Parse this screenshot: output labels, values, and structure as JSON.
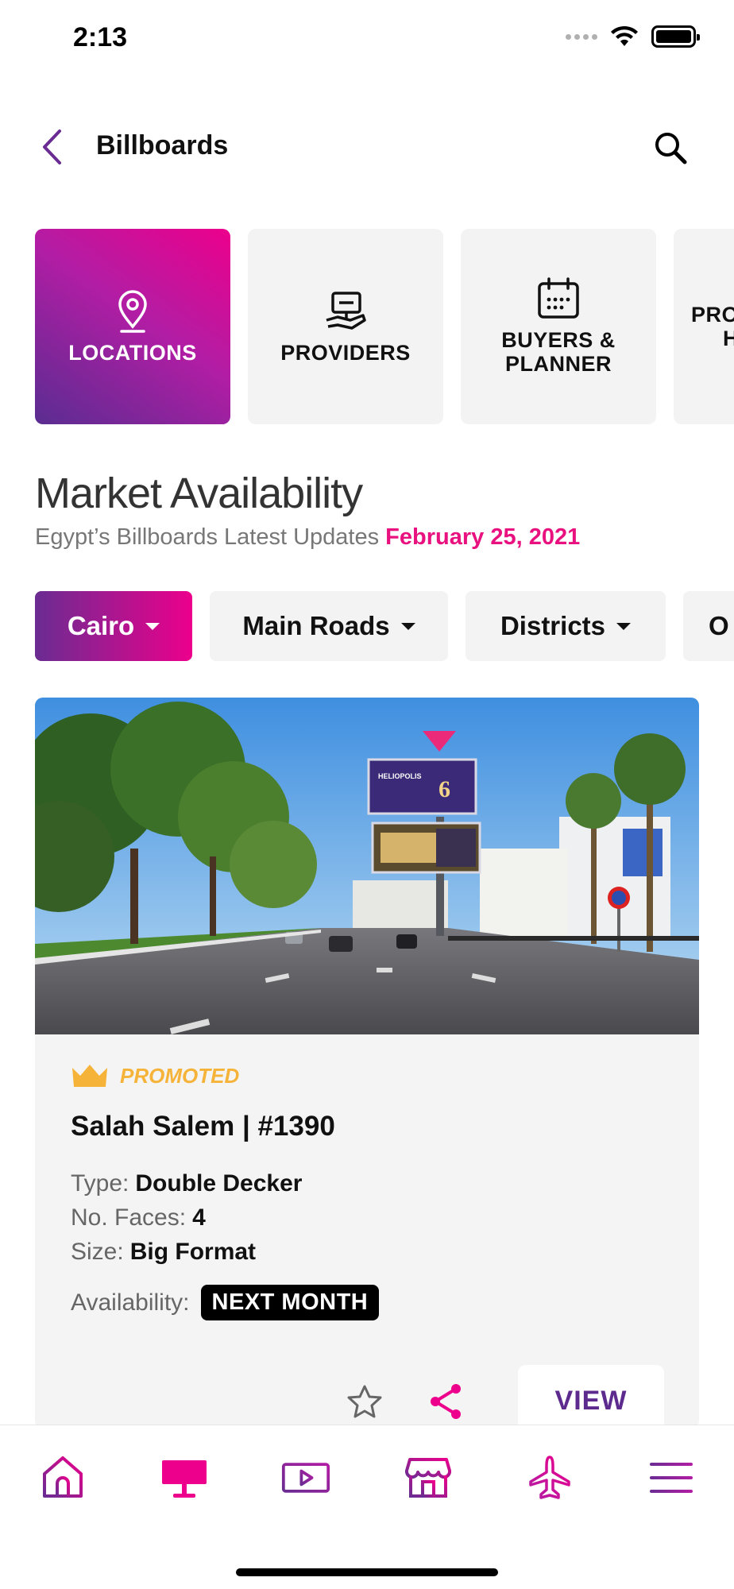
{
  "status_bar": {
    "time": "2:13"
  },
  "header": {
    "title": "Billboards"
  },
  "tiles": [
    {
      "label": "LOCATIONS",
      "icon": "location-pin-icon",
      "active": true
    },
    {
      "label": "PROVIDERS",
      "icon": "provider-icon",
      "active": false
    },
    {
      "label": "BUYERS & PLANNER",
      "icon": "calendar-icon",
      "active": false
    },
    {
      "label": "PRO H",
      "active": false
    }
  ],
  "market": {
    "title": "Market Availability",
    "subtitle": "Egypt’s Billboards Latest Updates",
    "date": "February 25, 2021"
  },
  "filters": [
    {
      "label": "Cairo",
      "active": true
    },
    {
      "label": "Main Roads",
      "active": false
    },
    {
      "label": "Districts",
      "active": false
    },
    {
      "label": "O",
      "active": false
    }
  ],
  "card": {
    "promoted_label": "PROMOTED",
    "title": "Salah Salem | #1390",
    "type_label": "Type:",
    "type_value": "Double Decker",
    "faces_label": "No. Faces:",
    "faces_value": "4",
    "size_label": "Size:",
    "size_value": "Big Format",
    "availability_label": "Availability:",
    "availability_value": "NEXT MONTH",
    "view_label": "VIEW",
    "billboard_top_text": "HELIOPOLIS",
    "billboard_number": "6"
  },
  "nav": [
    {
      "icon": "home-icon"
    },
    {
      "icon": "billboard-icon",
      "active": true
    },
    {
      "icon": "video-icon"
    },
    {
      "icon": "store-icon"
    },
    {
      "icon": "airplane-icon"
    },
    {
      "icon": "menu-icon"
    }
  ],
  "colors": {
    "accent_pink": "#ec008c",
    "accent_purple": "#5d2a8e",
    "promoted_gold": "#f6b339"
  }
}
